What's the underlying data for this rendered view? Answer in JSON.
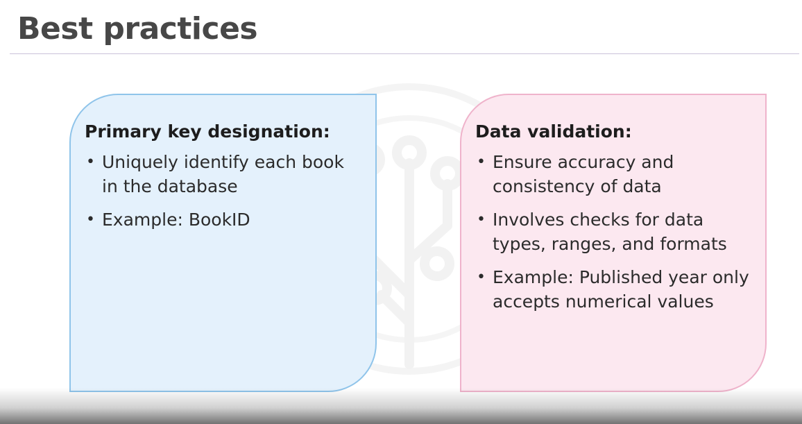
{
  "slide": {
    "title": "Best practices"
  },
  "cards": [
    {
      "heading": "Primary key designation:",
      "bullets": [
        "Uniquely identify each book in the database",
        "Example: BookID"
      ],
      "fill_color": "#e4f1fc",
      "border_color": "#8fc4ea"
    },
    {
      "heading": "Data validation:",
      "bullets": [
        "Ensure accuracy and consistency of data",
        "Involves checks for data types, ranges, and formats",
        "Example: Published year only accepts numerical values"
      ],
      "fill_color": "#fce8f0",
      "border_color": "#efb3cb"
    }
  ],
  "icons": {
    "watermark": "tree-logo-icon",
    "bullet": "bullet-dot-icon"
  },
  "colors": {
    "title_text": "#474747",
    "rule": "#c9c2da"
  }
}
